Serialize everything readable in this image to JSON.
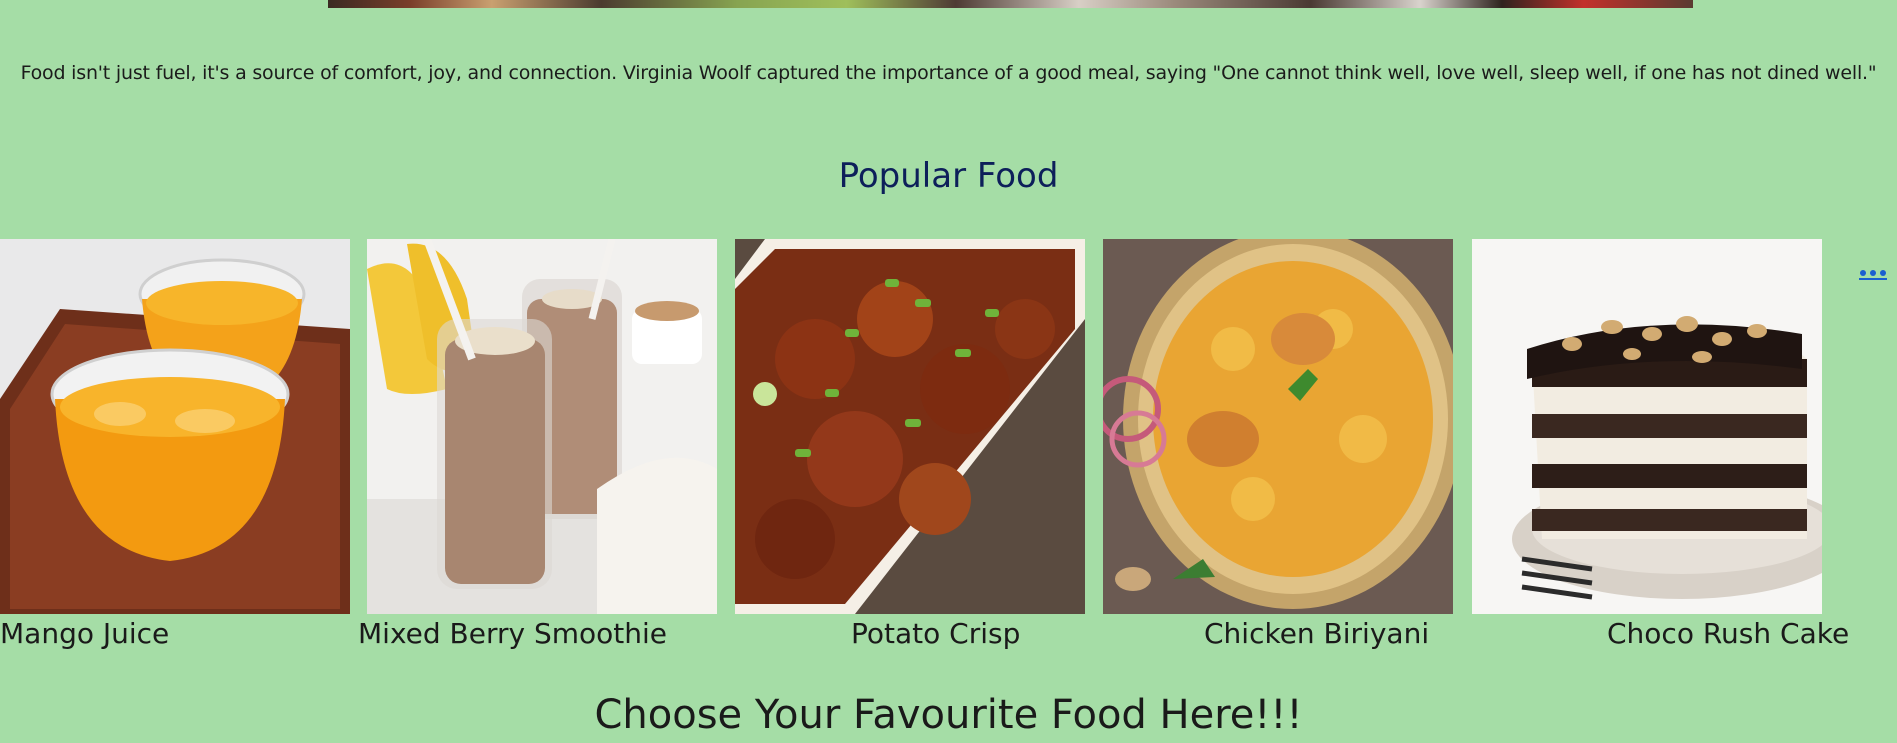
{
  "intro": {
    "quote": "Food isn't just fuel, it's a source of comfort, joy, and connection. Virginia Woolf captured the importance of a good meal, saying \"One cannot think well, love well, sleep well, if one has not dined well.\""
  },
  "popular": {
    "title": "Popular Food",
    "more_label": "...",
    "items": [
      {
        "name": "Mango Juice",
        "image": "mango-juice-image"
      },
      {
        "name": "Mixed Berry Smoothie",
        "image": "smoothie-image"
      },
      {
        "name": "Potato Crisp",
        "image": "potato-crisp-image"
      },
      {
        "name": "Chicken Biriyani",
        "image": "chicken-biriyani-image"
      },
      {
        "name": "Choco Rush Cake",
        "image": "choco-cake-image"
      }
    ]
  },
  "footer": {
    "title": "Choose Your Favourite Food Here!!!"
  },
  "colors": {
    "background": "#a5dda6",
    "title": "#0d1f5a",
    "link": "#1a5fd0"
  }
}
